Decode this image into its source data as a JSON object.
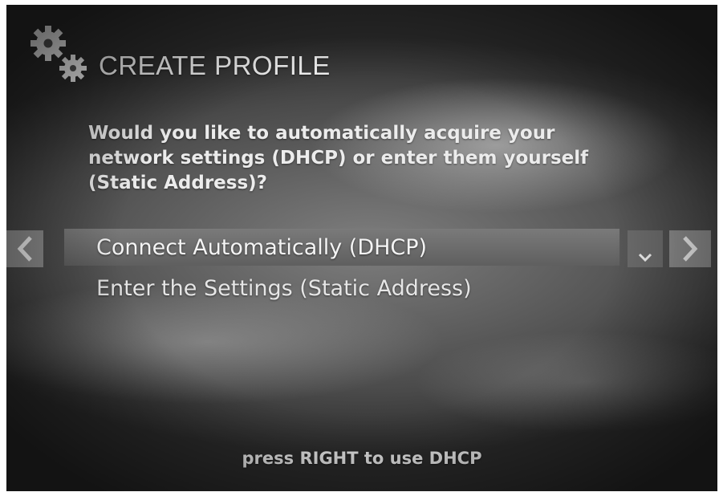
{
  "header": {
    "icon": "gears-icon",
    "title": "CREATE PROFILE"
  },
  "prompt": {
    "line1": "Would you like to automatically acquire your",
    "line2": "network settings (DHCP) or enter them yourself",
    "line3": "(Static Address)?"
  },
  "options": [
    {
      "label": "Connect Automatically (DHCP)",
      "selected": true
    },
    {
      "label": "Enter the Settings (Static Address)",
      "selected": false
    }
  ],
  "controls": {
    "left_icon": "chevron-left-icon",
    "right_icon": "chevron-right-icon",
    "dropdown_icon": "chevron-down-icon"
  },
  "footer": {
    "hint": "press RIGHT to use DHCP"
  },
  "colors": {
    "text": "#f2f2f2",
    "selected_bar": "#6e6e6e"
  }
}
